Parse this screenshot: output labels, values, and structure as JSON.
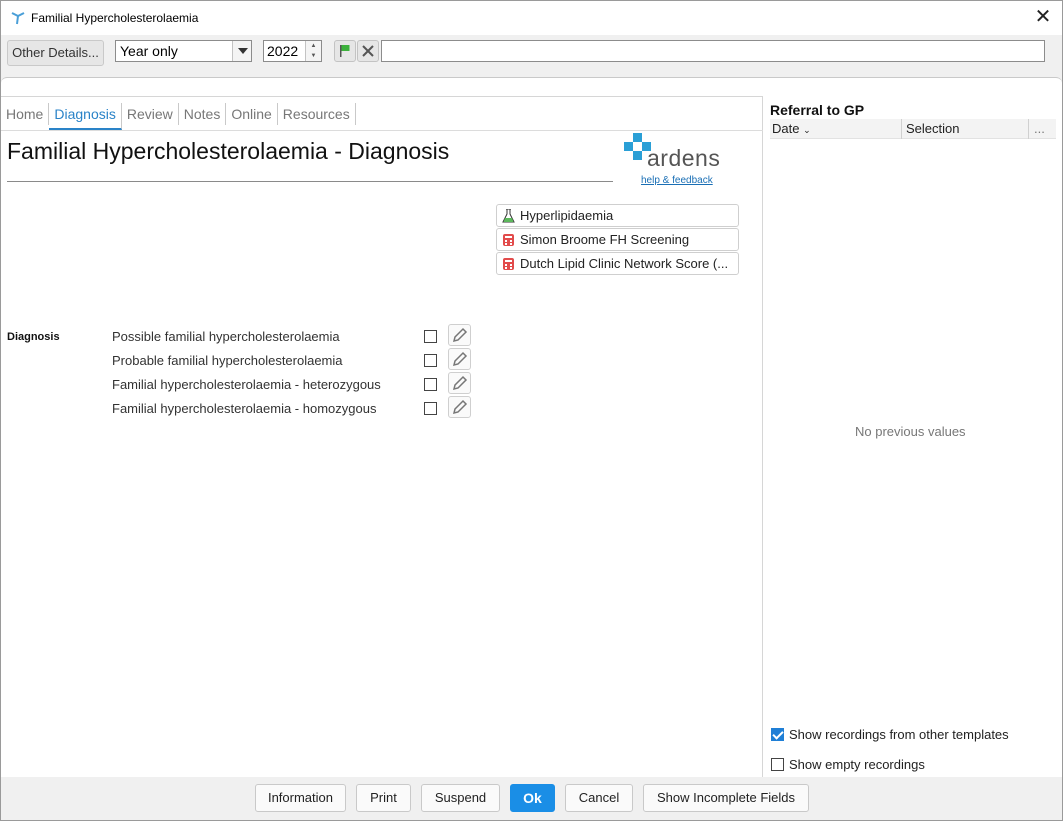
{
  "window": {
    "title": "Familial Hypercholesterolaemia",
    "close_glyph": "✕"
  },
  "toolbar": {
    "other_details_label": "Other Details...",
    "date_precision": "Year only",
    "year": "2022",
    "free_text": ""
  },
  "tabs": [
    {
      "label": "Home"
    },
    {
      "label": "Diagnosis",
      "active": true
    },
    {
      "label": "Review"
    },
    {
      "label": "Notes"
    },
    {
      "label": "Online"
    },
    {
      "label": "Resources"
    }
  ],
  "main": {
    "title": "Familial Hypercholesterolaemia - Diagnosis",
    "logo_text": "ardens",
    "help_link": "help & feedback",
    "links": [
      {
        "label": "Hyperlipidaemia",
        "icon": "flask-icon"
      },
      {
        "label": "Simon Broome FH Screening",
        "icon": "calculator-icon"
      },
      {
        "label": "Dutch Lipid Clinic Network Score (...",
        "icon": "calculator-icon"
      }
    ],
    "diagnosis_label": "Diagnosis",
    "options": [
      {
        "label": "Possible familial hypercholesterolaemia",
        "checked": false
      },
      {
        "label": "Probable familial hypercholesterolaemia",
        "checked": false
      },
      {
        "label": "Familial hypercholesterolaemia - heterozygous",
        "checked": false
      },
      {
        "label": "Familial hypercholesterolaemia - homozygous",
        "checked": false
      }
    ]
  },
  "side": {
    "title": "Referral to GP",
    "columns": {
      "date": "Date",
      "selection": "Selection",
      "more": "..."
    },
    "empty_text": "No previous values",
    "show_other_templates": "Show recordings from other templates",
    "show_other_templates_checked": true,
    "show_empty": "Show empty recordings",
    "show_empty_checked": false
  },
  "footer": {
    "information": "Information",
    "print": "Print",
    "suspend": "Suspend",
    "ok": "Ok",
    "cancel": "Cancel",
    "show_incomplete": "Show Incomplete Fields"
  },
  "colors": {
    "accent": "#1a8ee6",
    "tab_active": "#2a83c8",
    "logo_cross": "#2a9fd6"
  }
}
